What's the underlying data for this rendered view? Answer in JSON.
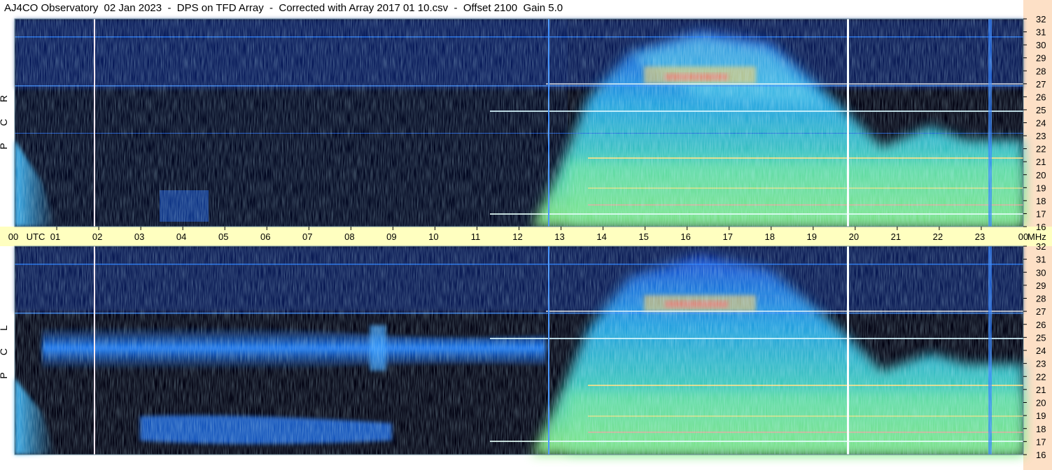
{
  "title": "AJ4CO Observatory  02 Jan 2023  -  DPS on TFD Array  -  Corrected with Array 2017 01 10.csv  -  Offset 2100  Gain 5.0",
  "chart_data": {
    "type": "heatmap",
    "panels": [
      {
        "label": [
          "R",
          "C",
          "P"
        ],
        "name": "RCP"
      },
      {
        "label": [
          "L",
          "C",
          "P"
        ],
        "name": "LCP"
      }
    ],
    "time_axis": {
      "labels": [
        "00",
        "UTC",
        "01",
        "02",
        "03",
        "04",
        "05",
        "06",
        "07",
        "08",
        "09",
        "10",
        "11",
        "12",
        "13",
        "14",
        "15",
        "16",
        "17",
        "18",
        "19",
        "20",
        "21",
        "22",
        "23",
        "00"
      ],
      "hours": [
        0,
        null,
        1,
        2,
        3,
        4,
        5,
        6,
        7,
        8,
        9,
        10,
        11,
        12,
        13,
        14,
        15,
        16,
        17,
        18,
        19,
        20,
        21,
        22,
        23,
        24
      ],
      "range": [
        0,
        24
      ]
    },
    "freq_axis": {
      "unit": "MHz",
      "ticks": [
        "32",
        "31",
        "30",
        "29",
        "28",
        "27",
        "26",
        "25",
        "24",
        "23",
        "22",
        "21",
        "20",
        "19",
        "18",
        "17",
        "16"
      ],
      "range": [
        16,
        32
      ]
    },
    "colorscale": [
      "#000010",
      "#001a5a",
      "#0a45c8",
      "#1e78ff",
      "#22b4f0",
      "#3ce0c8",
      "#9cf078",
      "#ffe050",
      "#ff6464"
    ]
  }
}
